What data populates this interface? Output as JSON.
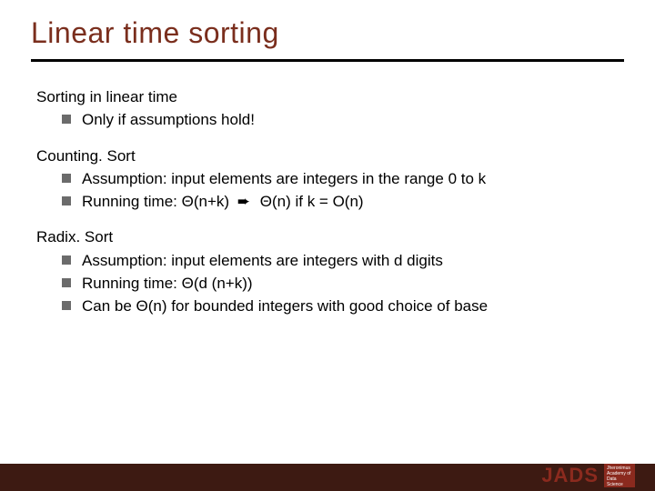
{
  "title": "Linear time sorting",
  "sections": [
    {
      "head": "Sorting in linear time",
      "items": [
        {
          "text": "Only if assumptions hold!"
        }
      ]
    },
    {
      "head": "Counting. Sort",
      "items": [
        {
          "text": "Assumption: input elements are integers in the range 0 to k"
        },
        {
          "prefix": "Running time: Θ(n+k)",
          "arrow": "➨",
          "suffix": "Θ(n) if k = O(n)"
        }
      ]
    },
    {
      "head": "Radix. Sort",
      "items": [
        {
          "text": "Assumption: input elements are integers with d digits"
        },
        {
          "text": "Running time: Θ(d (n+k))"
        },
        {
          "text": "Can be Θ(n) for bounded integers with good choice of base"
        }
      ]
    }
  ],
  "logo": {
    "text": "JADS",
    "box": "Jheronimus Academy of Data Science"
  }
}
